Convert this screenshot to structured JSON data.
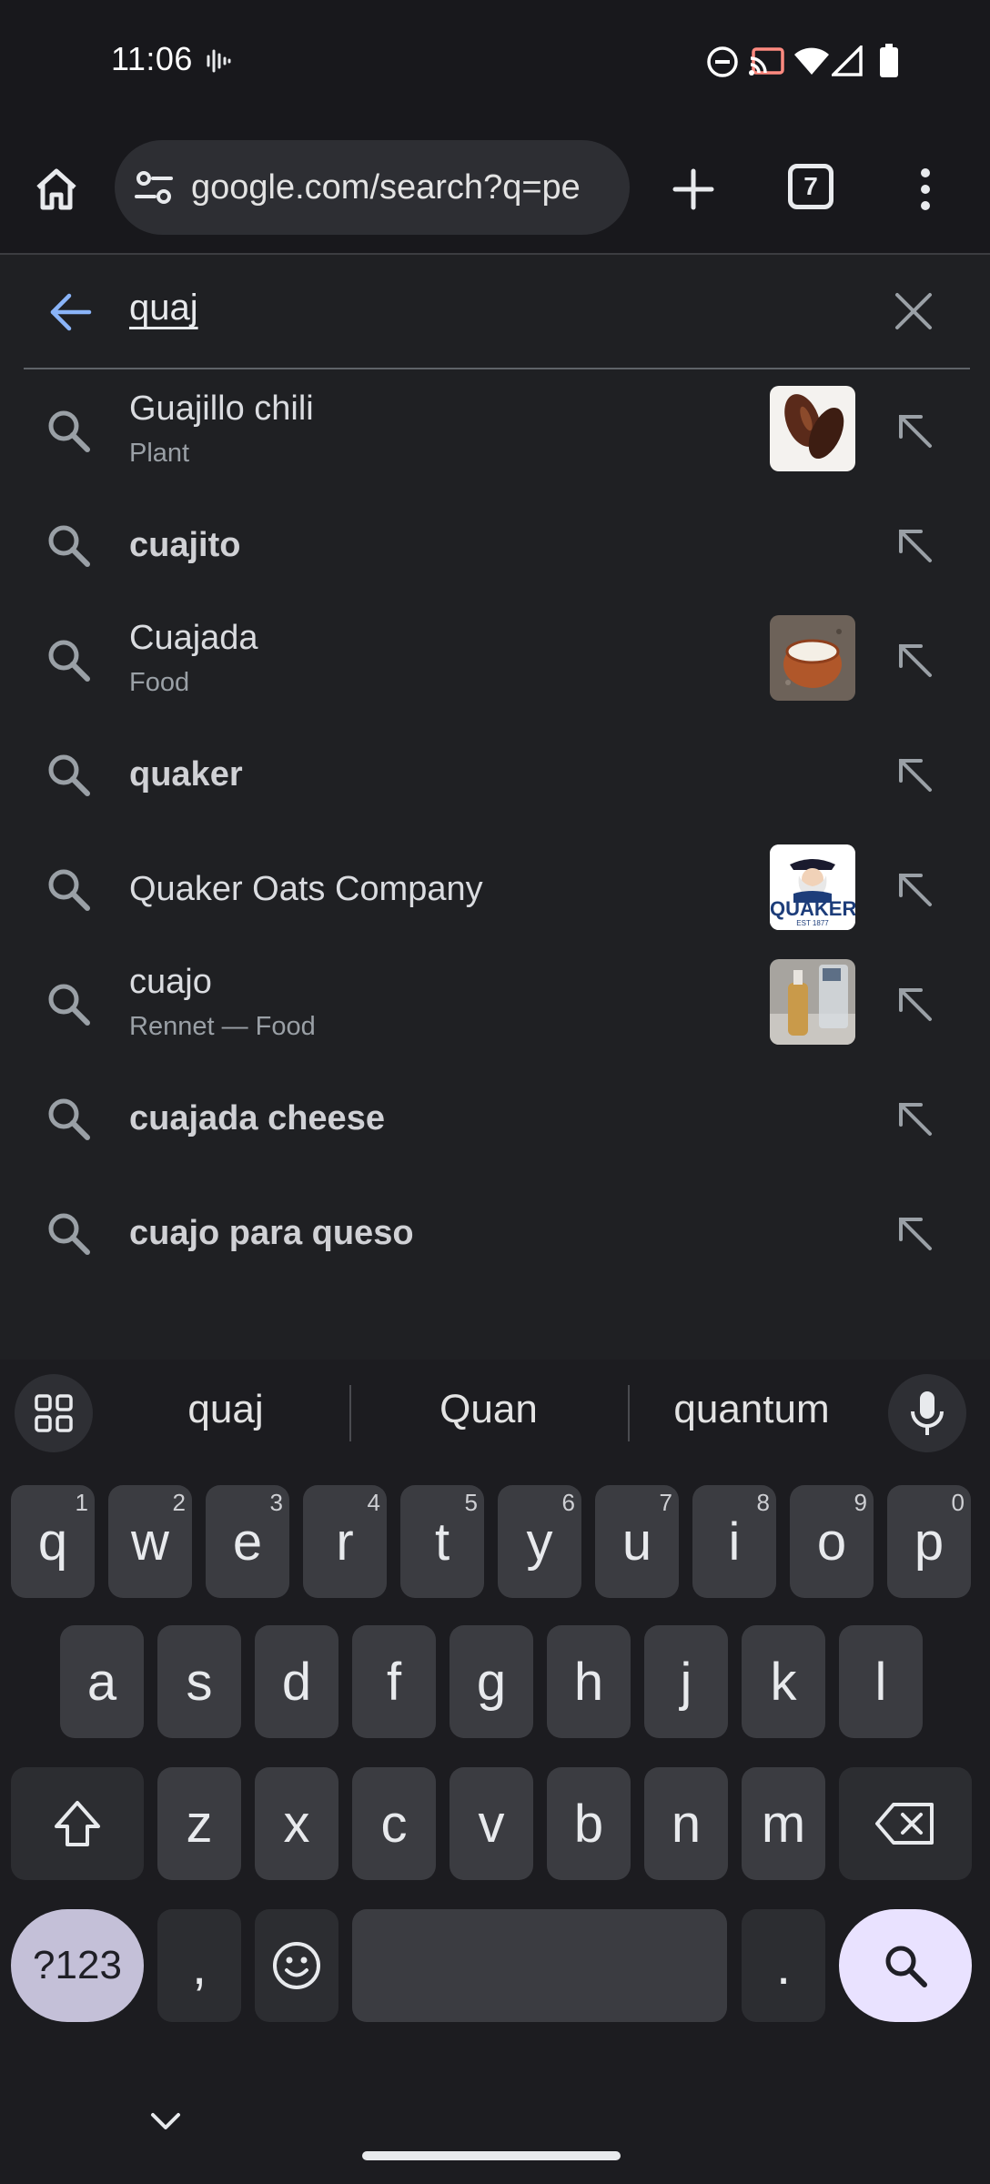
{
  "status_bar": {
    "time": "11:06"
  },
  "toolbar": {
    "url": "google.com/search?q=pe",
    "tab_count": "7"
  },
  "search": {
    "query": "quaj"
  },
  "suggestions": [
    {
      "title": "Guajillo chili",
      "subtitle": "Plant",
      "bold": false,
      "thumb": "dried-chili"
    },
    {
      "title": "cuajito",
      "subtitle": "",
      "bold": true,
      "thumb": ""
    },
    {
      "title": "Cuajada",
      "subtitle": "Food",
      "bold": false,
      "thumb": "clay-pot"
    },
    {
      "title": "quaker",
      "subtitle": "",
      "bold": true,
      "thumb": ""
    },
    {
      "title": "Quaker Oats Company",
      "subtitle": "",
      "bold": false,
      "thumb": "quaker-logo"
    },
    {
      "title": "cuajo",
      "subtitle": "Rennet — Food",
      "bold": false,
      "thumb": "bottle"
    },
    {
      "title": "cuajada cheese",
      "subtitle": "",
      "bold": true,
      "thumb": ""
    },
    {
      "title": "cuajo para queso",
      "subtitle": "",
      "bold": true,
      "thumb": ""
    }
  ],
  "thumb_text": {
    "quaker": "QUAKER",
    "quaker_est": "EST 1877"
  },
  "keyboard": {
    "suggestions": [
      "quaj",
      "Quan",
      "quantum"
    ],
    "row1": [
      {
        "key": "q",
        "hint": "1"
      },
      {
        "key": "w",
        "hint": "2"
      },
      {
        "key": "e",
        "hint": "3"
      },
      {
        "key": "r",
        "hint": "4"
      },
      {
        "key": "t",
        "hint": "5"
      },
      {
        "key": "y",
        "hint": "6"
      },
      {
        "key": "u",
        "hint": "7"
      },
      {
        "key": "i",
        "hint": "8"
      },
      {
        "key": "o",
        "hint": "9"
      },
      {
        "key": "p",
        "hint": "0"
      }
    ],
    "row2": [
      "a",
      "s",
      "d",
      "f",
      "g",
      "h",
      "j",
      "k",
      "l"
    ],
    "row3": [
      "z",
      "x",
      "c",
      "v",
      "b",
      "n",
      "m"
    ],
    "symbols_label": "?123",
    "comma": ",",
    "period": "."
  },
  "colors": {
    "background": "#1f2023",
    "accent_blue": "#8ab4f8",
    "search_key": "#e9e2ff"
  }
}
